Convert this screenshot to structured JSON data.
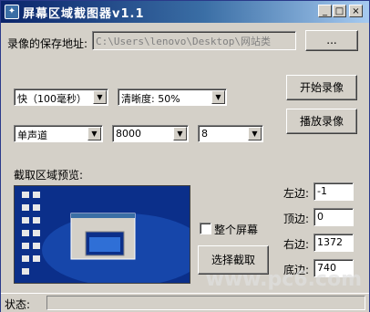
{
  "window": {
    "title": "屏幕区域截图器v1.1"
  },
  "titlebar": {
    "minimize": "_",
    "maximize": "□",
    "close": "×"
  },
  "save_path": {
    "label": "录像的保存地址:",
    "value": "C:\\Users\\lenovo\\Desktop\\网站类",
    "browse_label": "..."
  },
  "controls": {
    "speed": "快（100毫秒）",
    "clarity": "清晰度: 50%",
    "channel": "单声道",
    "sample_rate": "8000",
    "bits": "8",
    "start_label": "开始录像",
    "play_label": "播放录像"
  },
  "preview": {
    "label": "截取区域预览:"
  },
  "region": {
    "fullscreen_label": "整个屏幕",
    "select_label": "选择截取",
    "left_label": "左边:",
    "left_value": "-1",
    "top_label": "顶边:",
    "top_value": "0",
    "right_label": "右边:",
    "right_value": "1372",
    "bottom_label": "底边:",
    "bottom_value": "740"
  },
  "status": {
    "label": "状态:"
  },
  "watermark": "www.pc6.com",
  "colors": {
    "titlebar_start": "#0a246a",
    "titlebar_end": "#a6caf0",
    "face": "#d4d0c8",
    "desktop": "#0b2f8a"
  }
}
